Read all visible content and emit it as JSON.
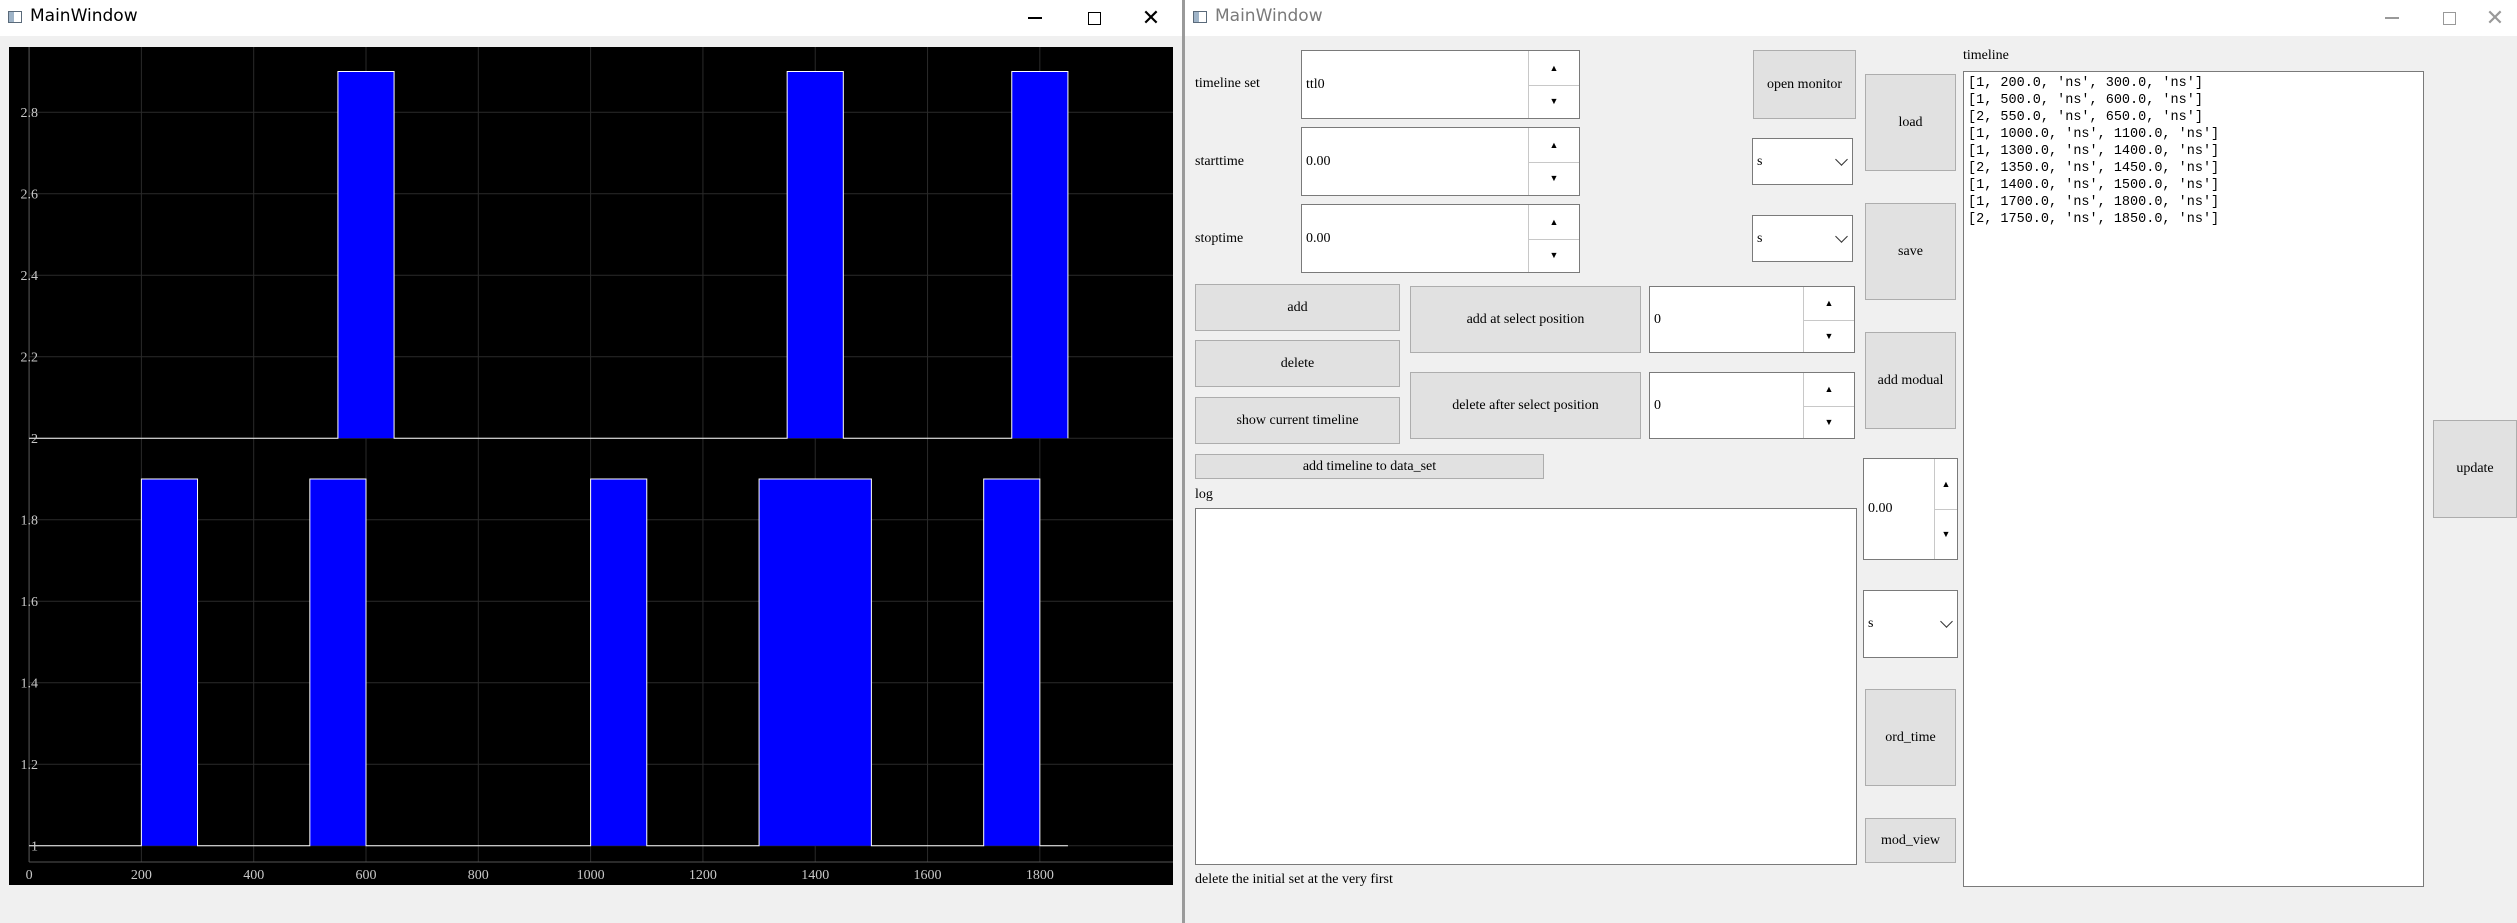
{
  "left_window": {
    "title": "MainWindow",
    "controls": {
      "minimize": "—",
      "maximize": "□",
      "close": "✕"
    }
  },
  "right_window": {
    "title": "MainWindow",
    "controls": {
      "minimize": "—",
      "maximize": "□",
      "close": "✕"
    },
    "timeline_set": {
      "label": "timeline set",
      "value": "ttl0"
    },
    "open_monitor": "open monitor",
    "starttime": {
      "label": "starttime",
      "value": "0.00",
      "unit": "s"
    },
    "stoptime": {
      "label": "stoptime",
      "value": "0.00",
      "unit": "s"
    },
    "buttons": {
      "load": "load",
      "save": "save",
      "add_modual": "add modual",
      "add": "add",
      "delete": "delete",
      "show_current_timeline": "show current timeline",
      "add_at_select_position": "add at select position",
      "delete_after_select_position": "delete after select position",
      "add_timeline_to_data_set": "add timeline to data_set",
      "ord_time": "ord_time",
      "mod_view": "mod_view",
      "update": "update"
    },
    "add_position_value": "0",
    "delete_position_value": "0",
    "offset": {
      "value": "0.00",
      "unit": "s"
    },
    "log": {
      "label": "log",
      "text": ""
    },
    "status_message": "delete the initial set at the very first",
    "timeline": {
      "label": "timeline",
      "entries": [
        "[1, 200.0, 'ns', 300.0, 'ns']",
        "[1, 500.0, 'ns', 600.0, 'ns']",
        "[2, 550.0, 'ns', 650.0, 'ns']",
        "[1, 1000.0, 'ns', 1100.0, 'ns']",
        "[1, 1300.0, 'ns', 1400.0, 'ns']",
        "[2, 1350.0, 'ns', 1450.0, 'ns']",
        "[1, 1400.0, 'ns', 1500.0, 'ns']",
        "[1, 1700.0, 'ns', 1800.0, 'ns']",
        "[2, 1750.0, 'ns', 1850.0, 'ns']"
      ]
    }
  },
  "chart_data": {
    "type": "area",
    "x_range": [
      -50,
      1900
    ],
    "xticks": [
      0,
      200,
      400,
      600,
      800,
      1000,
      1200,
      1400,
      1600,
      1800
    ],
    "y_range": [
      0.96,
      2.96
    ],
    "yticks": [
      "1",
      "1.2",
      "1.4",
      "1.6",
      "1.8",
      "2",
      "2.2",
      "2.4",
      "2.6",
      "2.8"
    ],
    "ytick_values": [
      1,
      1.2,
      1.4,
      1.6,
      1.8,
      2,
      2.2,
      2.4,
      2.6,
      2.8
    ],
    "grid": true,
    "background": "#000000",
    "fill_color": "#0000ff",
    "line_color": "#ffffff",
    "series": [
      {
        "baseline": 1,
        "high": 1.9,
        "x_start": 0,
        "x_end": 1850,
        "pulses": [
          [
            200,
            300
          ],
          [
            500,
            600
          ],
          [
            1000,
            1100
          ],
          [
            1300,
            1500
          ],
          [
            1700,
            1800
          ]
        ]
      },
      {
        "baseline": 2,
        "high": 2.9,
        "x_start": 0,
        "x_end": 1850,
        "pulses": [
          [
            550,
            650
          ],
          [
            1350,
            1450
          ],
          [
            1750,
            1850
          ]
        ]
      }
    ]
  }
}
